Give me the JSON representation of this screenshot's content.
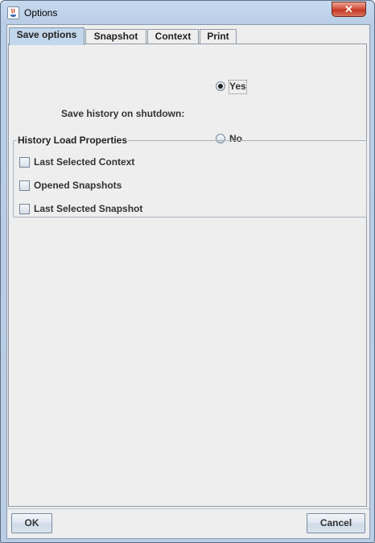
{
  "window": {
    "title": "Options",
    "close_label": "✕"
  },
  "tabs": [
    {
      "label": "Save options",
      "active": true
    },
    {
      "label": "Snapshot",
      "active": false
    },
    {
      "label": "Context",
      "active": false
    },
    {
      "label": "Print",
      "active": false
    }
  ],
  "save_options": {
    "label": "Save history on shutdown:",
    "yes_label": "Yes",
    "no_label": "No",
    "selected": "Yes"
  },
  "history_group": {
    "title": "History Load Properties",
    "items": [
      {
        "label": "Last Selected Context",
        "checked": false
      },
      {
        "label": "Opened Snapshots",
        "checked": false
      },
      {
        "label": "Last Selected Snapshot",
        "checked": false
      }
    ]
  },
  "buttons": {
    "ok": "OK",
    "cancel": "Cancel"
  }
}
